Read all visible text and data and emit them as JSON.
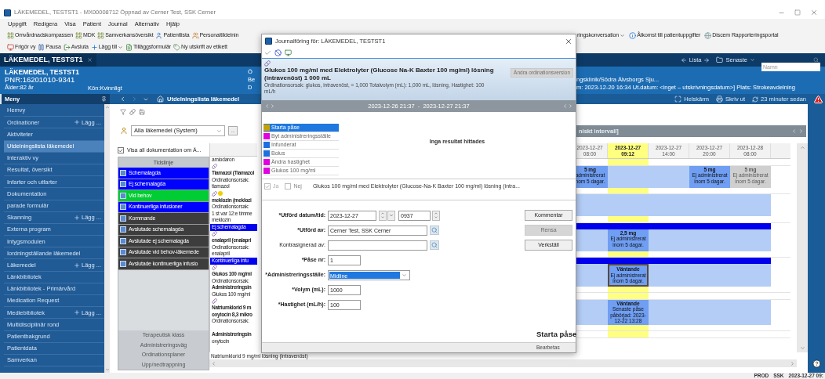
{
  "window": {
    "title": "LÄKEMEDEL, TESTST1 - MX00008712 Öppnad av Cerner Test, SSK Cerner"
  },
  "menu": [
    "Uppgift",
    "Redigera",
    "Visa",
    "Patient",
    "Journal",
    "Alternativ",
    "Hjälp"
  ],
  "toolbar_1": {
    "left": [
      {
        "label": "Omvårdnadskompassen",
        "dropdown": false
      },
      {
        "label": "MDK",
        "dropdown": false
      },
      {
        "label": "Samverkansöversikt",
        "dropdown": false
      },
      {
        "label": "Patientlista",
        "dropdown": false
      },
      {
        "label": "Personaltildelnin",
        "dropdown": false
      }
    ],
    "right": [
      {
        "label": "ringskonversation",
        "dropdown": true
      },
      {
        "label": "Åtkomst till patientuppgifter",
        "dropdown": false
      },
      {
        "label": "Discem Rapporteringsportal",
        "dropdown": false
      }
    ]
  },
  "toolbar_2": [
    {
      "label": "Frigör vy",
      "dropdown": false
    },
    {
      "label": "Pausa",
      "dropdown": false
    },
    {
      "label": "Avsluta",
      "dropdown": false
    },
    {
      "label": "Lägg till",
      "dropdown": true
    },
    {
      "label": "Tilläggsformulär",
      "dropdown": false
    },
    {
      "label": "Ny utskrift av etikett",
      "dropdown": false
    }
  ],
  "patient_tabs": {
    "tab": {
      "label": "LÄKEMEDEL, TESTST1",
      "selected": true
    },
    "list_button": "Lista",
    "recent_button": "Senaste",
    "search": {
      "placeholder": "Namn"
    }
  },
  "banner": {
    "name": "LÄKEMEDEL, TESTST1",
    "pnr": "PNR:16201010-9341",
    "age": "Ålder:82 år",
    "gender": "Kön:Kvinnligt",
    "cut_labels": [
      "Ö",
      "Be",
      "D"
    ],
    "right_lines": [
      "ngsklinik/Södra Älvsborgs Sju...",
      "m: 2023-12-20 16:34 Ut.datum: <inget – utskrivningsdatum>] Plats: Strokeavdelning"
    ]
  },
  "sidebar": {
    "header": "Meny",
    "items": [
      {
        "label": "Hemvy",
        "selected": false
      },
      {
        "label": "Ordinationer",
        "selected": false,
        "add": "Lägg ..."
      },
      {
        "label": "Aktiviteter",
        "selected": false
      },
      {
        "label": "Utdelningslista läkemedel",
        "selected": true
      },
      {
        "label": "Interaktiv vy",
        "selected": false
      },
      {
        "label": "Resultat, översikt",
        "selected": false
      },
      {
        "label": "Infarter och utfarter",
        "selected": false
      },
      {
        "label": "Dokumentation",
        "selected": false
      },
      {
        "label": "parade formulär",
        "selected": false
      },
      {
        "label": "Skanning",
        "selected": false,
        "add": "Lägg ..."
      },
      {
        "label": "Externa program",
        "selected": false
      },
      {
        "label": "Intygsmodulen",
        "selected": false
      },
      {
        "label": "Iordningställande läkemedel",
        "selected": false
      },
      {
        "label": "Läkemedel",
        "selected": false,
        "add": "Lägg ..."
      },
      {
        "label": "Länkbibliotek",
        "selected": false
      },
      {
        "label": "Länkbibliotek - Primärvård",
        "selected": false
      },
      {
        "label": "Medication Request",
        "selected": false
      },
      {
        "label": "Mediebibliotek",
        "selected": false,
        "add": "Lägg ..."
      },
      {
        "label": "Multidisciplinär rond",
        "selected": false
      },
      {
        "label": "Patientbakgrund",
        "selected": false
      },
      {
        "label": "Patientdata",
        "selected": false
      },
      {
        "label": "Samverkan",
        "selected": false
      }
    ]
  },
  "nav": {
    "title": "Utdelningslista läkemedel",
    "actions": [
      "Helskärm",
      "Skriv ut",
      "23 minuter sedan"
    ]
  },
  "filter": {
    "value": "Alla läkemedel (System)",
    "more": "...",
    "show_all": {
      "label": "Visa all dokumentation om Ä...",
      "checked": true
    }
  },
  "timeline": {
    "header": "Tidslinje",
    "items": [
      {
        "label": "Schemalagda",
        "color": "#0000ff",
        "checked": true
      },
      {
        "label": "Ej schemalagda",
        "color": "#0000ff",
        "checked": true
      },
      {
        "label": "Vid behov",
        "color": "#00cc33",
        "checked": true
      },
      {
        "label": "Kontinuerliga infusioner",
        "color": "#0000ff",
        "checked": true
      },
      {
        "label": "Kommande",
        "color": "#3d3d3d",
        "checked": true
      },
      {
        "label": "Avslutade schemalagda",
        "color": "#3d3d3d",
        "checked": true
      },
      {
        "label": "Avslutade ej schemalagda",
        "color": "#3d3d3d",
        "checked": true
      },
      {
        "label": "Avslutade vid behov-läkemede",
        "color": "#3d3d3d",
        "checked": true
      },
      {
        "label": "Avslutade kontinuerliga infusio",
        "color": "#3d3d3d",
        "checked": true
      }
    ],
    "footer": [
      "Terapeutisk klass",
      "Administreringsväg",
      "Ordinationsplaner",
      "Upp/nedtrappning"
    ]
  },
  "med_column": [
    {
      "kind": "plain",
      "text": "amiodaron"
    },
    {
      "kind": "icon"
    },
    {
      "kind": "bold",
      "text": "Tiamazol (Tiamazol"
    },
    {
      "kind": "plain",
      "text": "Ordinationsorsak:"
    },
    {
      "kind": "plain",
      "text": "tiamazol"
    },
    {
      "kind": "icon_note"
    },
    {
      "kind": "bold",
      "text": "meklozin (meklozi"
    },
    {
      "kind": "plain",
      "text": "Ordinationsorsak:"
    },
    {
      "kind": "plain",
      "text": "1 st var 12:e timme"
    },
    {
      "kind": "plain",
      "text": "meklozin"
    },
    {
      "kind": "band",
      "text": "Ej schemalagda"
    },
    {
      "kind": "icon"
    },
    {
      "kind": "bold",
      "text": "enalapril (enalapri"
    },
    {
      "kind": "plain",
      "text": "Ordinationsorsak:"
    },
    {
      "kind": "plain",
      "text": "enalapril"
    },
    {
      "kind": "band",
      "text": "Kontinuerliga infu"
    },
    {
      "kind": "icon"
    },
    {
      "kind": "bold",
      "text": "Glukos 100 mg/ml"
    },
    {
      "kind": "plain",
      "text": "Ordinationsorsak:"
    },
    {
      "kind": "bold",
      "text": "Administreringsin"
    },
    {
      "kind": "plain",
      "text": "Glukos 100 mg/ml"
    },
    {
      "kind": "icon"
    },
    {
      "kind": "bold",
      "text": "Natriumklorid 9 m"
    },
    {
      "kind": "bold",
      "text": "oxytocin 8,3 mikro"
    },
    {
      "kind": "plain",
      "text": "Ordinationsorsak:"
    },
    {
      "kind": "gap"
    },
    {
      "kind": "bold",
      "text": "Administreringsin"
    },
    {
      "kind": "plain",
      "text": "oxytocin"
    }
  ],
  "med_last_row": "Natriumklorid 9 mg/ml lösning (intravenöst)",
  "grid": {
    "band": "niskt intervall]",
    "columns": [
      {
        "date": "2023-12-27",
        "time": "08:00",
        "current": false
      },
      {
        "date": "2023-12-27",
        "time": "09:12",
        "current": true
      },
      {
        "date": "2023-12-27",
        "time": "14:00",
        "current": false
      },
      {
        "date": "2023-12-27",
        "time": "20:00",
        "current": false
      },
      {
        "date": "2023-12-28",
        "time": "08:00",
        "current": false
      }
    ],
    "rows": [
      {
        "kind": "gap"
      },
      {
        "kind": "data",
        "cells": [
          {
            "title": "5 mg",
            "text": "administrerat nom 5 dagar.",
            "faded": false,
            "outlined": false
          },
          null,
          null,
          {
            "title": "5 mg",
            "text": "Ej administrerat inom 5 dagar.",
            "faded": false,
            "outlined": false
          },
          {
            "title": "5 mg",
            "text": "Ej administrerat inom 5 dagar.",
            "faded": true,
            "outlined": false
          }
        ]
      },
      {
        "kind": "gap"
      },
      {
        "kind": "data",
        "cells": [
          null,
          null,
          null,
          null,
          null
        ]
      },
      {
        "kind": "gap"
      },
      {
        "kind": "bar"
      },
      {
        "kind": "data",
        "cells": [
          null,
          {
            "title": "2,5 mg",
            "text": "Ej administrerat inom 5 dagar.",
            "faded": false,
            "outlined": false
          },
          null,
          null,
          null
        ]
      },
      {
        "kind": "gap"
      },
      {
        "kind": "bar"
      },
      {
        "kind": "data",
        "cells": [
          null,
          {
            "title": "Väntande",
            "text": "Ej administrerat inom 5 dagar.",
            "faded": false,
            "outlined": true
          },
          null,
          null,
          null
        ]
      },
      {
        "kind": "gap"
      },
      {
        "kind": "gap"
      },
      {
        "kind": "data",
        "cells": [
          null,
          {
            "title": "Väntande",
            "text": "Senaste påse påbörjad: 2023-12-22 13:28",
            "faded": false,
            "outlined": false
          },
          null,
          null,
          null
        ]
      },
      {
        "kind": "gap"
      },
      {
        "kind": "gap"
      }
    ]
  },
  "dialog": {
    "title": "Journalföring för: LÄKEMEDEL, TESTST1",
    "order_title": "Glukos 100 mg/ml med Elektrolyter (Glucose Na-K Baxter 100 mg/ml) lösning (intravenöst) 1 000 mL",
    "order_reason": "Ordinationsorsak: glukos, intravenöst, = 1,000 Totalvolym (mL): 1,000 mL, lösning, Hastighet: 100 mL/h",
    "version_button": {
      "label": "Ändra ordinationsversion",
      "disabled": true
    },
    "range": "2023-12-26 21:37  -  2023-12-27 21:37",
    "tasks": [
      {
        "label": "Starta påse",
        "selected": true,
        "color": "#c8a000"
      },
      {
        "label": "Byt administreringsställe",
        "selected": false,
        "color": "#e000e0"
      },
      {
        "label": "Infunderat",
        "selected": false,
        "color": "#1e6fe0"
      },
      {
        "label": "Bolus",
        "selected": false,
        "color": "#1e6fe0"
      },
      {
        "label": "Ändra hastighet",
        "selected": false,
        "color": "#e000e0"
      },
      {
        "label": "Glukos 100 mg/ml",
        "selected": false,
        "color": "#e000e0"
      }
    ],
    "empty": "Inga resultat hittades",
    "yes": {
      "label": "Ja",
      "checked": true,
      "disabled": true
    },
    "no": {
      "label": "Nej",
      "checked": false,
      "disabled": false
    },
    "order_line": "Glukos 100 mg/ml med Elektrolyter (Glucose-Na-K Baxter 100 mg/ml) lösning (intra...",
    "fields": [
      {
        "kind": "datetime",
        "label": "*Utförd datum/tid:",
        "required": true,
        "value": "2023-12-27",
        "time": "0937"
      },
      {
        "kind": "lookup",
        "label": "*Utförd av:",
        "required": true,
        "value": "Cerner Test, SSK Cerner"
      },
      {
        "kind": "lookup",
        "label": "Kontrasignerad av:",
        "required": false
      },
      {
        "kind": "short",
        "label": "*Påse nr:",
        "required": true,
        "value": "1"
      },
      {
        "kind": "select",
        "label": "*Administreringsställe:",
        "required": true,
        "value": "Midline"
      },
      {
        "kind": "short",
        "label": "*Volym (mL):",
        "required": true,
        "value": "1000"
      },
      {
        "kind": "short",
        "label": "*Hastighet (mL/h):",
        "required": true,
        "value": "100"
      }
    ],
    "buttons": [
      {
        "label": "Kommentar",
        "disabled": false
      },
      {
        "label": "Rensa",
        "disabled": true
      },
      {
        "label": "Verkställ",
        "disabled": false
      }
    ],
    "footer_title": "Starta påse",
    "status": "Bearbetas"
  },
  "status_bar": [
    "PROD",
    "SSK",
    "2023-12-27 09:"
  ]
}
